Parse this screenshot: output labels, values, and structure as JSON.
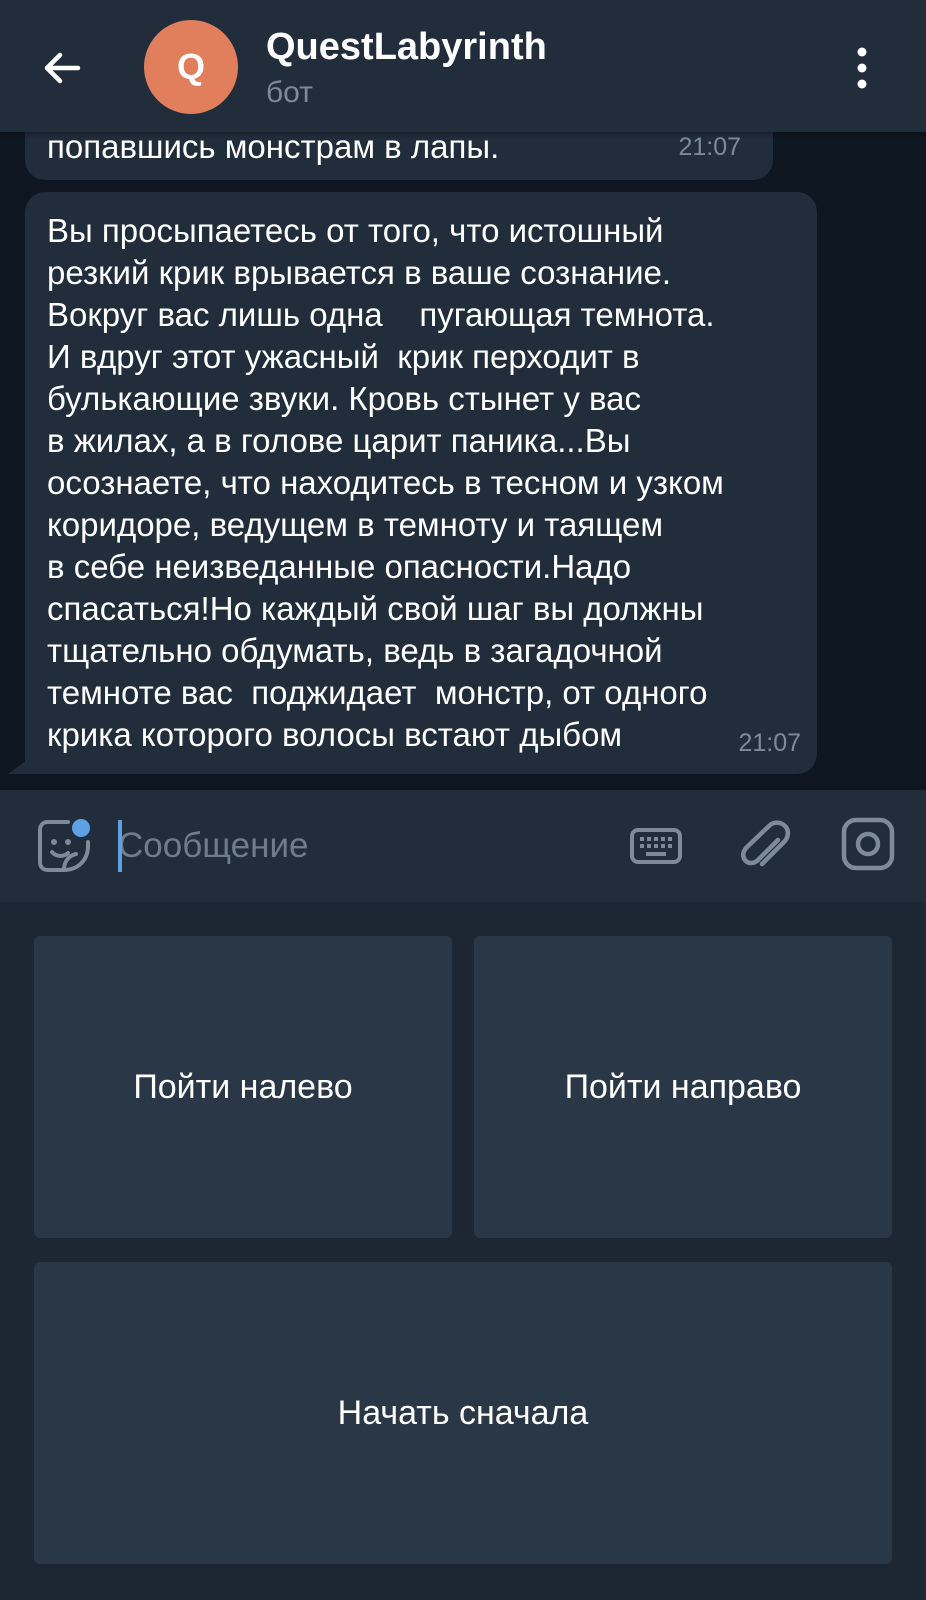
{
  "header": {
    "title": "QuestLabyrinth",
    "subtitle": "бот",
    "avatar_letter": "Q",
    "avatar_color": "#e17e5c",
    "back_icon": "arrow-left-icon",
    "menu_icon": "more-vertical-icon"
  },
  "messages": [
    {
      "text": "попавшись монстрам в лапы.",
      "time": "21:07"
    },
    {
      "text": "Вы просыпаетесь от того, что истошный\nрезкий крик врывается в ваше сознание.\nВокруг вас лишь одна    пугающая темнота.\nИ вдруг этот ужасный  крик перходит в\nбулькающие звуки. Кровь стынет у вас\nв жилах, а в голове царит паника...Вы\nосознаете, что находитесь в тесном и узком\nкоридоре, ведущем в темноту и таящем\nв себе неизведанные опасности.Надо\nспасаться!Но каждый свой шаг вы должны\nтщательно обдумать, ведь в загадочной\nтемноте вас  поджидает  монстр, от одного\nкрика которого волосы встают дыбом",
      "time": "21:07"
    }
  ],
  "composer": {
    "placeholder": "Сообщение",
    "value": "",
    "icons": [
      "sticker-icon",
      "keyboard-icon",
      "paperclip-icon",
      "camera-icon"
    ],
    "accent": "#5ea0e6"
  },
  "keyboard": {
    "buttons": [
      {
        "label": "Пойти налево"
      },
      {
        "label": "Пойти направо"
      },
      {
        "label": "Начать сначала"
      }
    ]
  }
}
